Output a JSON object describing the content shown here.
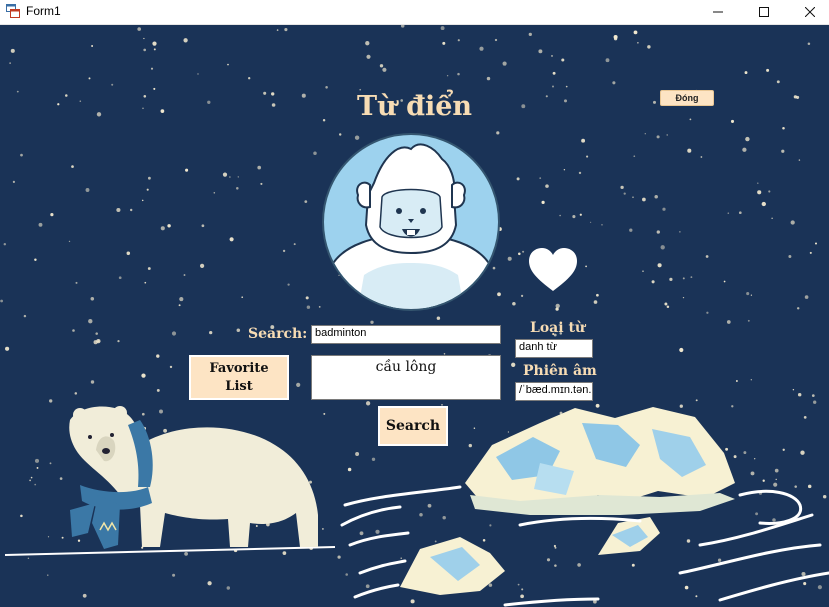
{
  "window": {
    "title": "Form1",
    "minimize_icon": "minimize-icon",
    "maximize_icon": "maximize-icon",
    "close_icon": "close-icon"
  },
  "app": {
    "title": "Từ điển",
    "close_button": "Đóng",
    "avatar": "yeti-avatar",
    "favorite_icon": "heart-icon"
  },
  "search": {
    "label": "Search:",
    "value": "badminton",
    "button": "Search"
  },
  "result": {
    "meaning": "cầu lông",
    "word_type_label": "Loại từ",
    "word_type_value": "danh từ",
    "phonetic_label": "Phiên âm",
    "phonetic_value": "/ˈbæd.mɪn.tən."
  },
  "favorite_list_button": "Favorite List",
  "colors": {
    "background": "#1a3357",
    "accent": "#f7dcb4",
    "button": "#fde4c4"
  }
}
